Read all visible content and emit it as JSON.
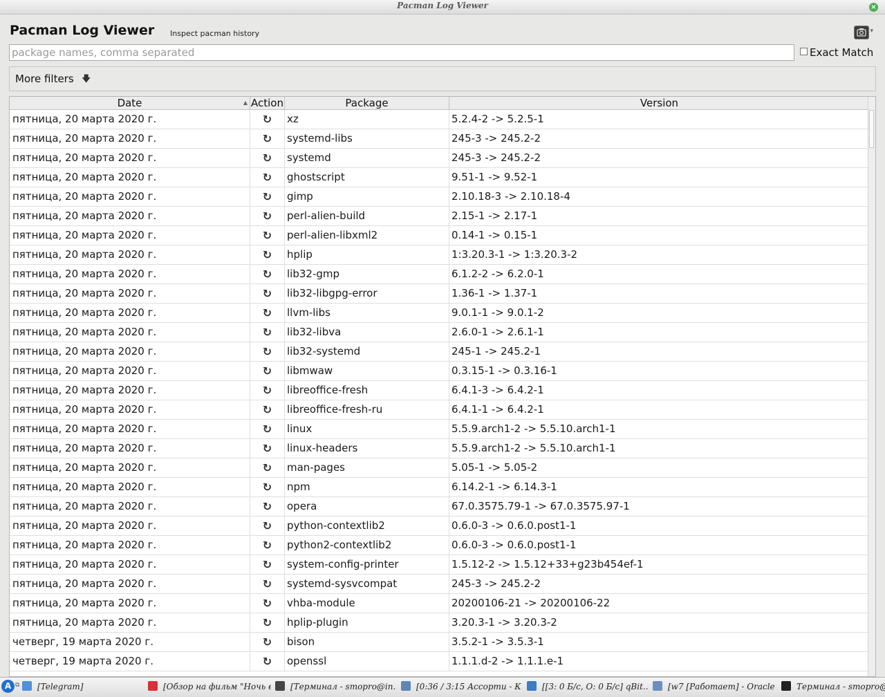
{
  "window": {
    "wm_title": "Pacman Log Viewer"
  },
  "header": {
    "title": "Pacman Log Viewer",
    "subtitle": "Inspect pacman history"
  },
  "search": {
    "placeholder": "package names, comma separated",
    "value": ""
  },
  "exact_match": {
    "label": "Exact Match",
    "checked": false
  },
  "filters": {
    "label": "More filters",
    "icon": "arrow-down-icon"
  },
  "table": {
    "columns": [
      "Date",
      "Action",
      "Package",
      "Version"
    ],
    "sorted_column": "Date",
    "action_icon": "upgrade-icon",
    "rows": [
      {
        "date": "пятница, 20 марта 2020 г.",
        "action": "↻",
        "package": "xz",
        "version": "5.2.4-2 -> 5.2.5-1"
      },
      {
        "date": "пятница, 20 марта 2020 г.",
        "action": "↻",
        "package": "systemd-libs",
        "version": "245-3 -> 245.2-2"
      },
      {
        "date": "пятница, 20 марта 2020 г.",
        "action": "↻",
        "package": "systemd",
        "version": "245-3 -> 245.2-2"
      },
      {
        "date": "пятница, 20 марта 2020 г.",
        "action": "↻",
        "package": "ghostscript",
        "version": "9.51-1 -> 9.52-1"
      },
      {
        "date": "пятница, 20 марта 2020 г.",
        "action": "↻",
        "package": "gimp",
        "version": "2.10.18-3 -> 2.10.18-4"
      },
      {
        "date": "пятница, 20 марта 2020 г.",
        "action": "↻",
        "package": "perl-alien-build",
        "version": "2.15-1 -> 2.17-1"
      },
      {
        "date": "пятница, 20 марта 2020 г.",
        "action": "↻",
        "package": "perl-alien-libxml2",
        "version": "0.14-1 -> 0.15-1"
      },
      {
        "date": "пятница, 20 марта 2020 г.",
        "action": "↻",
        "package": "hplip",
        "version": "1:3.20.3-1 -> 1:3.20.3-2"
      },
      {
        "date": "пятница, 20 марта 2020 г.",
        "action": "↻",
        "package": "lib32-gmp",
        "version": "6.1.2-2 -> 6.2.0-1"
      },
      {
        "date": "пятница, 20 марта 2020 г.",
        "action": "↻",
        "package": "lib32-libgpg-error",
        "version": "1.36-1 -> 1.37-1"
      },
      {
        "date": "пятница, 20 марта 2020 г.",
        "action": "↻",
        "package": "llvm-libs",
        "version": "9.0.1-1 -> 9.0.1-2"
      },
      {
        "date": "пятница, 20 марта 2020 г.",
        "action": "↻",
        "package": "lib32-libva",
        "version": "2.6.0-1 -> 2.6.1-1"
      },
      {
        "date": "пятница, 20 марта 2020 г.",
        "action": "↻",
        "package": "lib32-systemd",
        "version": "245-1 -> 245.2-1"
      },
      {
        "date": "пятница, 20 марта 2020 г.",
        "action": "↻",
        "package": "libmwaw",
        "version": "0.3.15-1 -> 0.3.16-1"
      },
      {
        "date": "пятница, 20 марта 2020 г.",
        "action": "↻",
        "package": "libreoffice-fresh",
        "version": "6.4.1-3 -> 6.4.2-1"
      },
      {
        "date": "пятница, 20 марта 2020 г.",
        "action": "↻",
        "package": "libreoffice-fresh-ru",
        "version": "6.4.1-1 -> 6.4.2-1"
      },
      {
        "date": "пятница, 20 марта 2020 г.",
        "action": "↻",
        "package": "linux",
        "version": "5.5.9.arch1-2 -> 5.5.10.arch1-1"
      },
      {
        "date": "пятница, 20 марта 2020 г.",
        "action": "↻",
        "package": "linux-headers",
        "version": "5.5.9.arch1-2 -> 5.5.10.arch1-1"
      },
      {
        "date": "пятница, 20 марта 2020 г.",
        "action": "↻",
        "package": "man-pages",
        "version": "5.05-1 -> 5.05-2"
      },
      {
        "date": "пятница, 20 марта 2020 г.",
        "action": "↻",
        "package": "npm",
        "version": "6.14.2-1 -> 6.14.3-1"
      },
      {
        "date": "пятница, 20 марта 2020 г.",
        "action": "↻",
        "package": "opera",
        "version": "67.0.3575.79-1 -> 67.0.3575.97-1"
      },
      {
        "date": "пятница, 20 марта 2020 г.",
        "action": "↻",
        "package": "python-contextlib2",
        "version": "0.6.0-3 -> 0.6.0.post1-1"
      },
      {
        "date": "пятница, 20 марта 2020 г.",
        "action": "↻",
        "package": "python2-contextlib2",
        "version": "0.6.0-3 -> 0.6.0.post1-1"
      },
      {
        "date": "пятница, 20 марта 2020 г.",
        "action": "↻",
        "package": "system-config-printer",
        "version": "1.5.12-2 -> 1.5.12+33+g23b454ef-1"
      },
      {
        "date": "пятница, 20 марта 2020 г.",
        "action": "↻",
        "package": "systemd-sysvcompat",
        "version": "245-3 -> 245.2-2"
      },
      {
        "date": "пятница, 20 марта 2020 г.",
        "action": "↻",
        "package": "vhba-module",
        "version": "20200106-21 -> 20200106-22"
      },
      {
        "date": "пятница, 20 марта 2020 г.",
        "action": "↻",
        "package": "hplip-plugin",
        "version": "3.20.3-1 -> 3.20.3-2"
      },
      {
        "date": "четверг, 19 марта 2020 г.",
        "action": "↻",
        "package": "bison",
        "version": "3.5.2-1 -> 3.5.3-1"
      },
      {
        "date": "четверг, 19 марта 2020 г.",
        "action": "↻",
        "package": "openssl",
        "version": "1.1.1.d-2 -> 1.1.1.e-1"
      }
    ]
  },
  "taskbar": {
    "tasks": [
      {
        "label": "[Telegram]",
        "icon": "telegram-icon",
        "color": "#4f92d8"
      },
      {
        "label": "[Обзор на фильм \"Ночь в...",
        "icon": "opera-icon",
        "color": "#d9303a"
      },
      {
        "label": "[Терминал - smopro@in...",
        "icon": "terminal-icon",
        "color": "#444444"
      },
      {
        "label": "[0:36 / 3:15 Ассорти - К...",
        "icon": "media-icon",
        "color": "#5f86b3"
      },
      {
        "label": "[[3: 0 Б/с, О: 0 Б/с] qBit...",
        "icon": "qbittorrent-icon",
        "color": "#3f7cc1"
      },
      {
        "label": "[w7 [Работает] - Oracle ...",
        "icon": "virtualbox-icon",
        "color": "#6b8fbf"
      },
      {
        "label": "Терминал - smopro@i",
        "icon": "terminal-icon",
        "color": "#222222"
      }
    ]
  }
}
